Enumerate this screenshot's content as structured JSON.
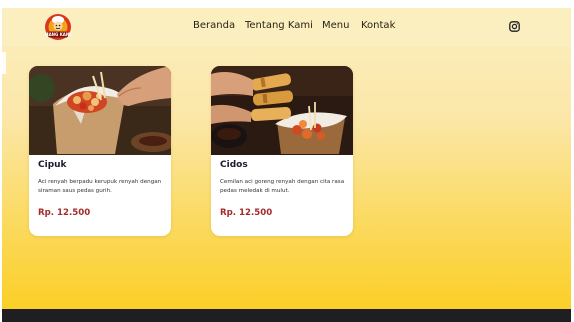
{
  "brand": {
    "logo_text": "MANG KAMI",
    "logo_icon": "chef-mascot-logo"
  },
  "nav": {
    "items": [
      {
        "label": "Beranda"
      },
      {
        "label": "Tentang Kami"
      },
      {
        "label": "Menu"
      },
      {
        "label": "Kontak"
      }
    ],
    "social_icon": "instagram-icon"
  },
  "menu": {
    "cards": [
      {
        "title": "Cipuk",
        "description": "Aci renyah berpadu kerupuk renyah dengan siraman saus pedas gurih.",
        "price": "Rp. 12.500",
        "image": "fried-snack-in-paper-bag-photo"
      },
      {
        "title": "Cidos",
        "description": "Cemilan aci goreng renyah dengan cita rasa pedas meledak di mulut.",
        "price": "Rp. 12.500",
        "image": "fried-snack-sticks-photo"
      }
    ]
  },
  "colors": {
    "nav_bg": "#fbeebf",
    "gradient_top": "#fbeec0",
    "gradient_bottom": "#fbcd1f",
    "price": "#a52a2a",
    "footer": "#1f1e22"
  }
}
